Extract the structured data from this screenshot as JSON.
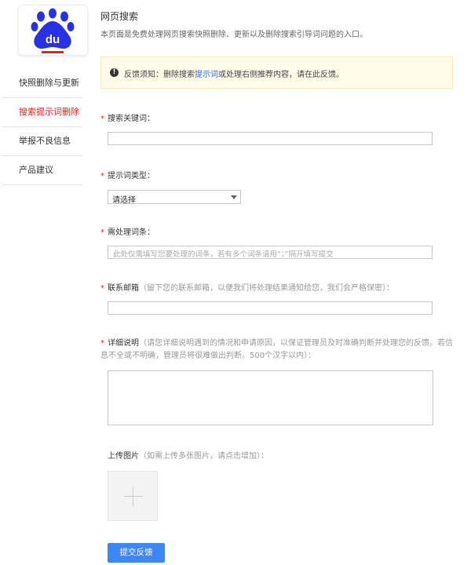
{
  "logo": {
    "text": "du",
    "icon": "baidu-paw-icon"
  },
  "sidebar": {
    "items": [
      {
        "label": "快照删除与更新"
      },
      {
        "label": "搜索提示词删除"
      },
      {
        "label": "举报不良信息"
      },
      {
        "label": "产品建议"
      }
    ],
    "active_index": 1
  },
  "header": {
    "title": "网页搜索",
    "description": "本页面是免费处理网页搜索快照删除、更新以及删除搜索引导词问题的入口。"
  },
  "notice": {
    "icon": "exclamation-circle-icon",
    "prefix": "反馈须知：删除搜索",
    "link": "提示词",
    "suffix": "或处理右侧推荐内容，请在此反馈。"
  },
  "form": {
    "required_mark": "*",
    "keyword": {
      "label": "搜索关键词：",
      "value": ""
    },
    "type": {
      "label": "提示词类型：",
      "selected": "请选择"
    },
    "terms": {
      "label": "需处理词条：",
      "placeholder": "此处仅需填写您要处理的词条，若有多个词条请用“；”隔开填写提交"
    },
    "email": {
      "label": "联系邮箱",
      "hint": "（留下您的联系邮箱，以便我们将处理结果通知给您，我们会严格保密）：",
      "value": ""
    },
    "detail": {
      "label": "详细说明",
      "hint": "（请您详细说明遇到的情况和申请原因，以保证管理员及时准确判断并处理您的反馈。若信息不全或不明确，管理员将很难做出判断。500个汉字以内）：",
      "value": ""
    },
    "upload": {
      "label": "上传图片",
      "hint": "（如需上传多张图片，请点击增加）：",
      "icon": "plus-icon"
    },
    "submit_label": "提交反馈"
  },
  "colors": {
    "accent": "#3f86f5",
    "active": "#e2231a",
    "logo_blue": "#2932e1"
  }
}
